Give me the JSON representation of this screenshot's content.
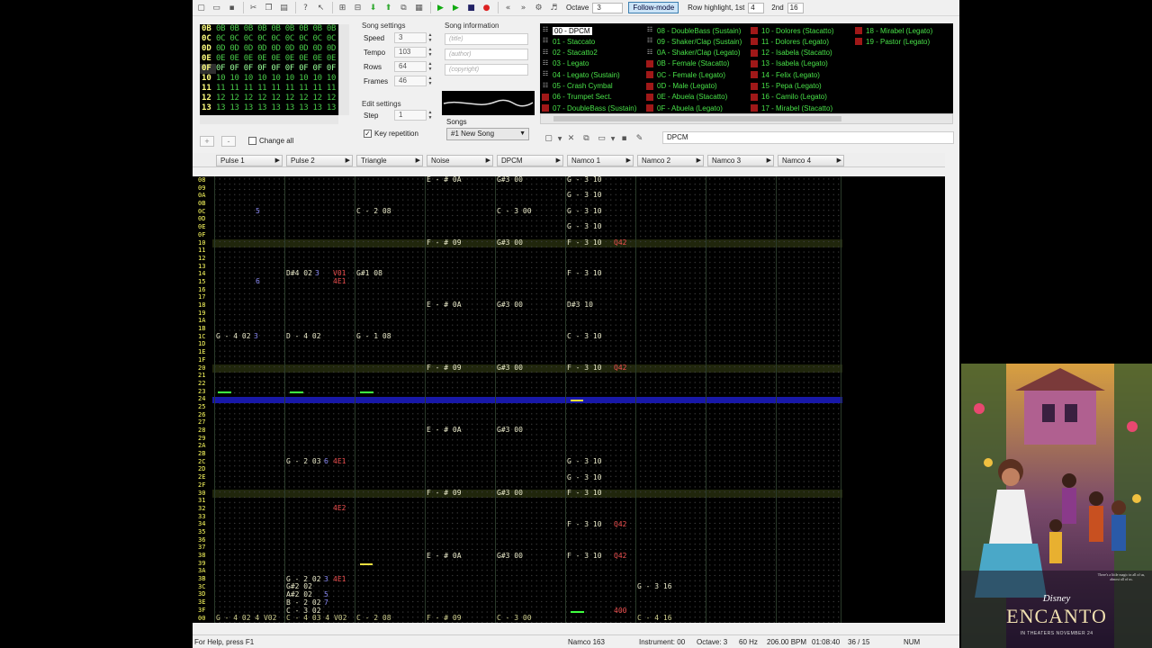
{
  "toolbar": {
    "octave_label": "Octave",
    "octave_value": "3",
    "follow_mode": "Follow-mode",
    "row_highlight_label": "Row highlight, 1st",
    "row_highlight_1st": "4",
    "second_label": "2nd",
    "row_highlight_2nd": "16"
  },
  "frames": {
    "rows": [
      {
        "num": "0B",
        "cells": "0B 0B 0B 0B 0B 0B 0B 0B 0B"
      },
      {
        "num": "0C",
        "cells": "0C 0C 0C 0C 0C 0C 0C 0C 0C"
      },
      {
        "num": "0D",
        "cells": "0D 0D 0D 0D 0D 0D 0D 0D 0D"
      },
      {
        "num": "0E",
        "cells": "0E 0E 0E 0E 0E 0E 0E 0E 0E"
      },
      {
        "num": "0F",
        "cells": "0F 0F 0F 0F 0F 0F 0F 0F 0F"
      },
      {
        "num": "10",
        "cells": "10 10 10 10 10 10 10 10 10"
      },
      {
        "num": "11",
        "cells": "11 11 11 11 11 11 11 11 11"
      },
      {
        "num": "12",
        "cells": "12 12 12 12 12 12 12 12 12"
      },
      {
        "num": "13",
        "cells": "13 13 13 13 13 13 13 13 13"
      }
    ],
    "change_all": "Change all",
    "add_label": "+",
    "remove_label": "-"
  },
  "song_settings": {
    "title": "Song settings",
    "speed_label": "Speed",
    "speed": "3",
    "tempo_label": "Tempo",
    "tempo": "103",
    "rows_label": "Rows",
    "rows": "64",
    "frames_label": "Frames",
    "frames": "46"
  },
  "edit_settings": {
    "title": "Edit settings",
    "step_label": "Step",
    "step": "1",
    "key_repetition": "Key repetition"
  },
  "song_info": {
    "title": "Song information",
    "title_placeholder": "(title)",
    "author_placeholder": "(author)",
    "copyright_placeholder": "(copyright)",
    "songs_label": "Songs",
    "song_selected": "#1 New Song"
  },
  "instruments": [
    {
      "label": "00 - DPCM",
      "type": "dpcm"
    },
    {
      "label": "01 - Staccato",
      "type": "dpcm"
    },
    {
      "label": "02 - Stacatto2",
      "type": "dpcm"
    },
    {
      "label": "03 - Legato",
      "type": "dpcm"
    },
    {
      "label": "04 - Legato (Sustain)",
      "type": "dpcm"
    },
    {
      "label": "05 - Crash Cymbal",
      "type": "dpcm"
    },
    {
      "label": "06 - Trumpet Sect.",
      "type": "namco"
    },
    {
      "label": "07 - DoubleBass (Sustain)",
      "type": "namco"
    },
    {
      "label": "08 - DoubleBass (Sustain)",
      "type": "dpcm"
    },
    {
      "label": "09 - Shaker/Clap (Sustain)",
      "type": "dpcm"
    },
    {
      "label": "0A - Shaker/Clap (Legato)",
      "type": "dpcm"
    },
    {
      "label": "0B - Female (Stacatto)",
      "type": "namco"
    },
    {
      "label": "0C - Female (Legato)",
      "type": "namco"
    },
    {
      "label": "0D - Male (Legato)",
      "type": "namco"
    },
    {
      "label": "0E - Abuela (Stacatto)",
      "type": "namco"
    },
    {
      "label": "0F - Abuela (Legato)",
      "type": "namco"
    },
    {
      "label": "10 - Dolores (Stacatto)",
      "type": "namco"
    },
    {
      "label": "11 - Dolores (Legato)",
      "type": "namco"
    },
    {
      "label": "12 - Isabela (Stacatto)",
      "type": "namco"
    },
    {
      "label": "13 - Isabela (Legato)",
      "type": "namco"
    },
    {
      "label": "14 - Felix (Legato)",
      "type": "namco"
    },
    {
      "label": "15 - Pepa (Legato)",
      "type": "namco"
    },
    {
      "label": "16 - Camilo (Legato)",
      "type": "namco"
    },
    {
      "label": "17 - Mirabel (Stacatto)",
      "type": "namco"
    },
    {
      "label": "18 - Mirabel (Legato)",
      "type": "namco"
    },
    {
      "label": "19 - Pastor (Legato)",
      "type": "namco"
    }
  ],
  "instrument_name": "DPCM",
  "channels": [
    "Pulse 1",
    "Pulse 2",
    "Triangle",
    "Noise",
    "DPCM",
    "Namco 1",
    "Namco 2",
    "Namco 3",
    "Namco 4"
  ],
  "row_numbers": [
    "08",
    "09",
    "0A",
    "0B",
    "0C",
    "0D",
    "0E",
    "0F",
    "10",
    "11",
    "12",
    "13",
    "14",
    "15",
    "16",
    "17",
    "18",
    "19",
    "1A",
    "1B",
    "1C",
    "1D",
    "1E",
    "1F",
    "20",
    "21",
    "22",
    "23",
    "24",
    "25",
    "26",
    "27",
    "28",
    "29",
    "2A",
    "2B",
    "2C",
    "2D",
    "2E",
    "2F",
    "30",
    "31",
    "32",
    "33",
    "34",
    "35",
    "36",
    "37",
    "38",
    "39",
    "3A",
    "3B",
    "3C",
    "3D",
    "3E",
    "3F",
    "00"
  ],
  "pattern": {
    "noise_0A": "E - # 0A",
    "dpcm_0A": "G#3 00",
    "noise_09": "F - # 09",
    "dpcm_09": "G#3 00",
    "namco_G3": "G - 3 10",
    "namco_F3": "F - 3 10",
    "namco_C3": "C - 3 10",
    "namco_Ds3": "D#3 10",
    "q42": "Q42",
    "p1_5": "5",
    "p1_6": "6",
    "p1_1c_note": "G - 4 02",
    "p1_1c_vol": "3",
    "p2_14_note": "D#4 02",
    "p2_14_vol": "3",
    "p2_14_eff1": "V01",
    "p2_14_eff2": "4E1",
    "p2_1c": "D - 4 02",
    "p2_2c_note": "G - 2 03",
    "p2_2c_vol": "6",
    "p2_2c_eff": "4E1",
    "p2_32_eff": "4E2",
    "p2_3b_note": "G - 2 02",
    "p2_3b_vol": "3",
    "p2_3b_eff": "4E1",
    "p2_3c": "G#2 02",
    "p2_3d_note": "A#2 02",
    "p2_3d_vol": "5",
    "p2_3e_note": "B - 2 02",
    "p2_3e_vol": "7",
    "p2_3f": "C - 3 02",
    "tri_0c": "C - 2 08",
    "tri_14": "G#1 08",
    "tri_1c": "G - 1 08",
    "dpcm_0c": "C - 3 00",
    "n2_3c": "G - 3 16",
    "n1_3f": "400",
    "bottom_p1": "G - 4 02 4 V02",
    "bottom_p2": "C - 4 03 4 V02",
    "bottom_tri": "C - 2 08",
    "bottom_noise": "F - # 09",
    "bottom_dpcm": "C - 3 00",
    "bottom_n2": "C - 4 16"
  },
  "status": {
    "help": "For Help, press F1",
    "channel": "Namco 163",
    "instrument": "Instrument: 00",
    "octave": "Octave: 3",
    "rate": "60 Hz",
    "bpm": "206.00 BPM",
    "time": "01:08:40",
    "position": "36 / 15",
    "num": "NUM"
  },
  "poster": {
    "brand": "Disney",
    "title": "ENCANTO",
    "tagline": "There's a little magic in all of us, almost all of us.",
    "release": "IN THEATERS NOVEMBER 24"
  }
}
